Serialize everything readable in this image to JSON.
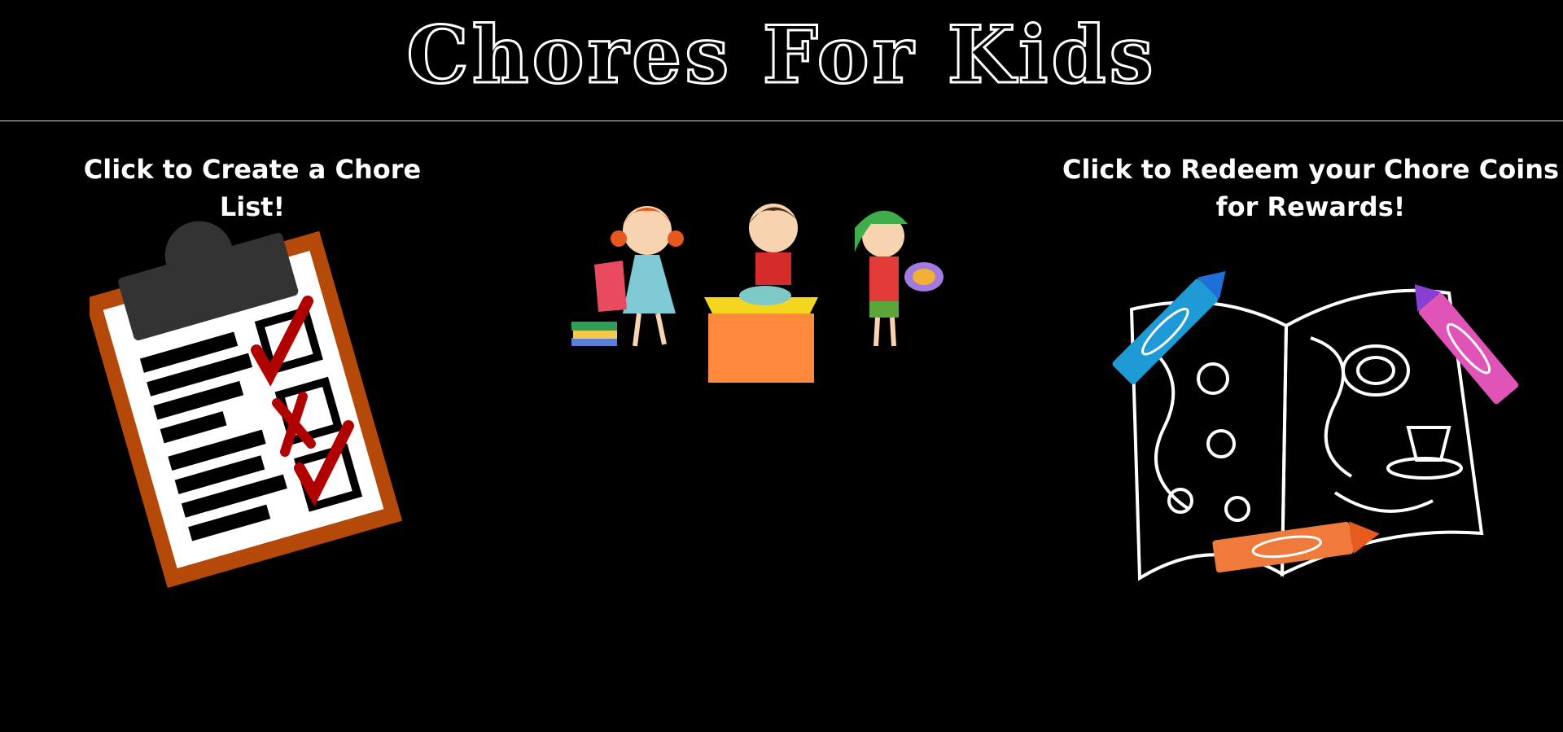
{
  "header": {
    "title": "Chores For Kids"
  },
  "create_panel": {
    "caption": "Click to Create a Chore List!",
    "icon": "clipboard-checklist-icon"
  },
  "center_panel": {
    "icon": "kids-doing-chores-illustration"
  },
  "redeem_panel": {
    "caption": "Click to Redeem your Chore Coins for Rewards!",
    "icon": "coloring-book-crayons-icon"
  },
  "colors": {
    "background": "#000000",
    "text": "#ffffff",
    "clipboard_frame": "#b5490a",
    "check_red": "#b00000",
    "crayon_blue": "#1e9bd7",
    "crayon_pink": "#e054b8",
    "crayon_orange": "#f07a3c"
  }
}
